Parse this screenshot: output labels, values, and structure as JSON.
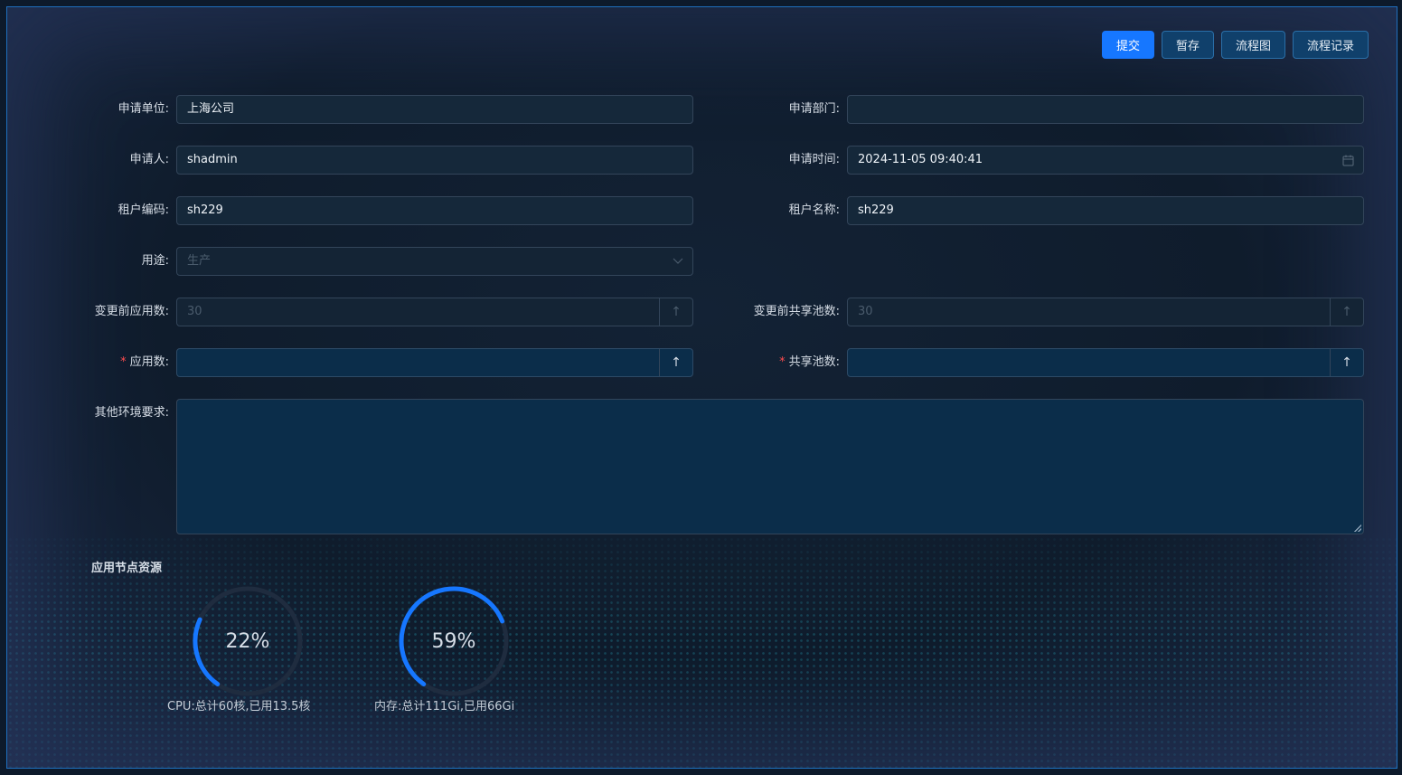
{
  "toolbar": {
    "submit": "提交",
    "save_draft": "暂存",
    "flowchart": "流程图",
    "flow_record": "流程记录"
  },
  "form": {
    "applicant_unit": {
      "label": "申请单位:",
      "value": "上海公司"
    },
    "applicant_dept": {
      "label": "申请部门:",
      "value": ""
    },
    "applicant": {
      "label": "申请人:",
      "value": "shadmin"
    },
    "apply_time": {
      "label": "申请时间:",
      "value": "2024-11-05 09:40:41",
      "icon": "calendar-icon"
    },
    "tenant_code": {
      "label": "租户编码:",
      "value": "sh229"
    },
    "tenant_name": {
      "label": "租户名称:",
      "value": "sh229"
    },
    "purpose": {
      "label": "用途:",
      "value": "生产",
      "icon": "chevron-down-icon"
    },
    "app_count_before": {
      "label": "变更前应用数:",
      "value": "30"
    },
    "pool_count_before": {
      "label": "变更前共享池数:",
      "value": "30"
    },
    "app_count": {
      "required_mark": "*",
      "label": "应用数:",
      "value": ""
    },
    "pool_count": {
      "required_mark": "*",
      "label": "共享池数:",
      "value": ""
    },
    "other_requirements": {
      "label": "其他环境要求:",
      "value": ""
    }
  },
  "resources": {
    "title": "应用节点资源",
    "gauges": [
      {
        "name": "cpu",
        "percent": 22,
        "percent_text": "22%",
        "caption": "CPU:总计60核,已用13.5核"
      },
      {
        "name": "memory",
        "percent": 59,
        "percent_text": "59%",
        "caption": "内存:总计111Gi,已用66Gi"
      }
    ]
  },
  "colors": {
    "accent": "#1677ff",
    "gauge_track": "#1f2c3f",
    "required": "#ff4d4f"
  }
}
